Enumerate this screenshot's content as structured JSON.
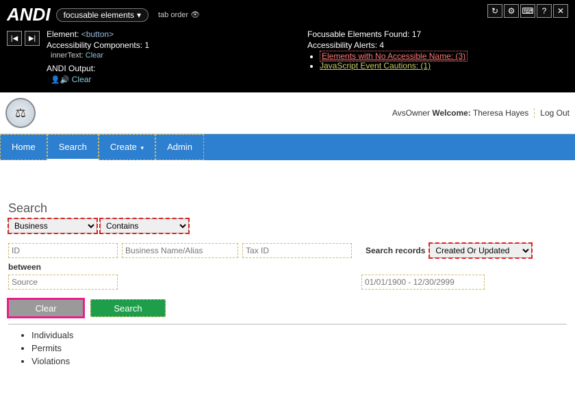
{
  "andi": {
    "title": "ANDI",
    "module": "focusable elements",
    "taborder": "tab order",
    "icons": {
      "refresh": "↻",
      "gear": "⚙",
      "keyboard": "⌨",
      "help": "?",
      "close": "✕",
      "prev": "|◀",
      "next": "▶|"
    },
    "element_label": "Element:",
    "element_value": "<button>",
    "components_label": "Accessibility Components:",
    "components_value": "1",
    "inner_label": "innerText:",
    "inner_value": "Clear",
    "output_label": "ANDI Output:",
    "output_value": "Clear",
    "found_label": "Focusable Elements Found:",
    "found_value": "17",
    "alerts_label": "Accessibility Alerts:",
    "alerts_value": "4",
    "alert1_text": "Elements with No Accessible Name:",
    "alert1_count": "(3)",
    "alert2_text": "JavaScript Event Cautions:",
    "alert2_count": "(1)"
  },
  "header": {
    "app": "AvsOwner",
    "welcome_label": "Welcome:",
    "user": "Theresa Hayes",
    "logout": "Log Out"
  },
  "nav": {
    "home": "Home",
    "search": "Search",
    "create": "Create",
    "admin": "Admin"
  },
  "search": {
    "title": "Search",
    "type_select": "Business",
    "match_select": "Contains",
    "ph_id": "ID",
    "ph_name": "Business Name/Alias",
    "ph_tax": "Tax ID",
    "ph_source": "Source",
    "records_label": "Search records",
    "records_select": "Created Or Updated",
    "between_label": "between",
    "ph_date": "01/01/1900 - 12/30/2999",
    "clear": "Clear",
    "search_btn": "Search",
    "results": [
      "Individuals",
      "Permits",
      "Violations"
    ]
  }
}
